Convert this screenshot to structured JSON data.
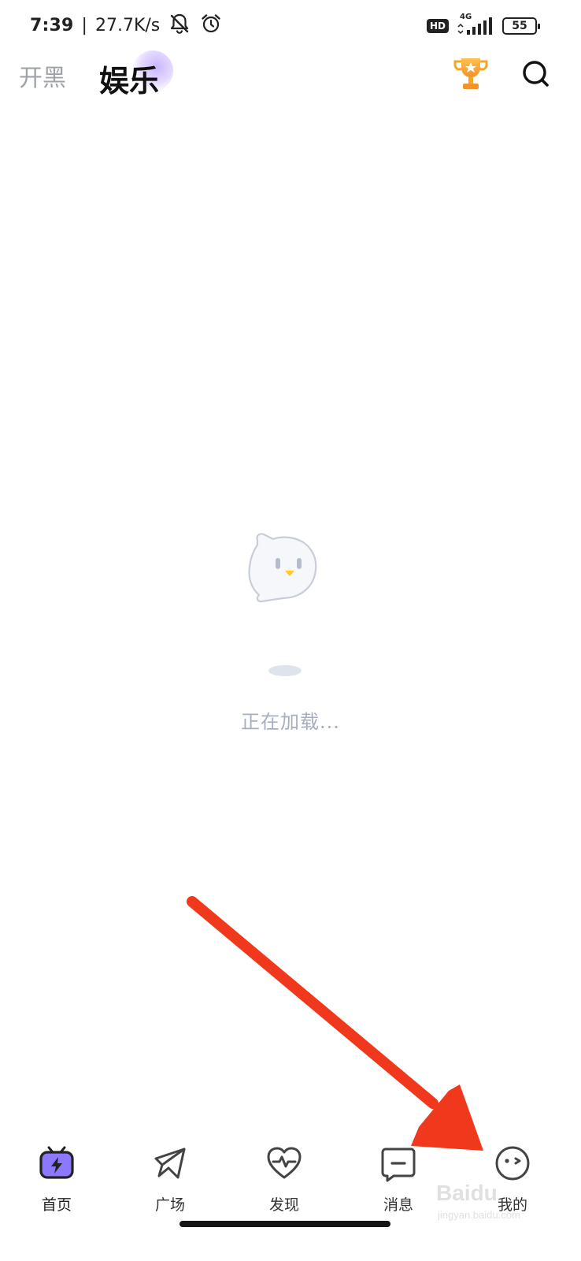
{
  "status_bar": {
    "time": "7:39",
    "separator": "|",
    "network_speed": "27.7K/s",
    "hd_label": "HD",
    "network_type": "4G",
    "battery": "55"
  },
  "header": {
    "tab_kaihei": "开黑",
    "tab_yule": "娱乐"
  },
  "loading": {
    "text": "正在加载..."
  },
  "bottom_nav": {
    "items": [
      {
        "label": "首页",
        "icon": "home-tv-icon",
        "active": true
      },
      {
        "label": "广场",
        "icon": "paper-plane-icon",
        "active": false
      },
      {
        "label": "发现",
        "icon": "heart-pulse-icon",
        "active": false
      },
      {
        "label": "消息",
        "icon": "message-icon",
        "active": false
      },
      {
        "label": "我的",
        "icon": "face-icon",
        "active": false
      }
    ]
  },
  "watermark": {
    "brand": "Baidu",
    "sub": "jingyan.baidu.com"
  },
  "colors": {
    "accent_purple": "#7b61ff",
    "arrow_red": "#f0381c",
    "trophy_gold": "#f5a623",
    "loading_text": "#a6aebf"
  }
}
